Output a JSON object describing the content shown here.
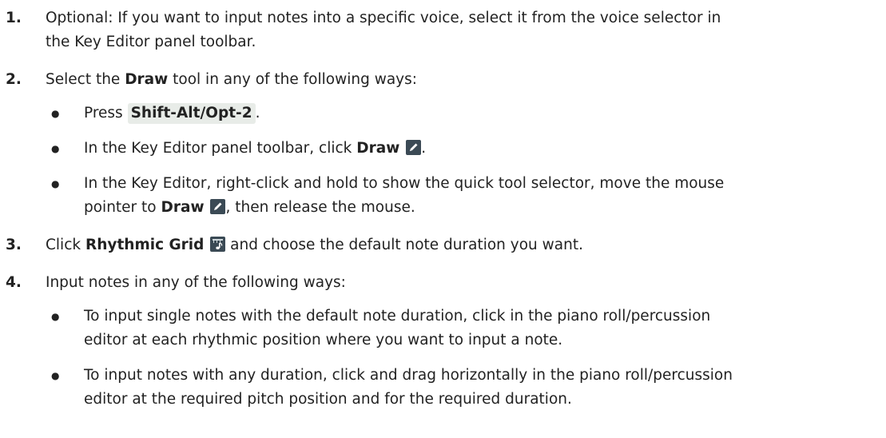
{
  "steps": [
    {
      "number": "1.",
      "line1": "Optional: If you want to input notes into a specific voice, select it from the voice selector in",
      "line2": "the Key Editor panel toolbar."
    },
    {
      "number": "2.",
      "text": "Select the ",
      "bold": "Draw",
      "text_after": " tool in any of the following ways:",
      "bullets": [
        {
          "pre": "Press ",
          "kbd": "Shift-Alt/Opt-2",
          "post": "."
        },
        {
          "pre": "In the Key Editor panel toolbar, click ",
          "bold": "Draw",
          "icon": "pencil-icon",
          "post": "."
        },
        {
          "line1": "In the Key Editor, right-click and hold to show the quick tool selector, move the mouse",
          "pre": "pointer to ",
          "bold": "Draw",
          "icon": "pencil-icon",
          "post": ", then release the mouse."
        }
      ]
    },
    {
      "number": "3.",
      "pre": "Click ",
      "bold": "Rhythmic Grid",
      "icon": "rhythmic-grid-icon",
      "post": " and choose the default note duration you want."
    },
    {
      "number": "4.",
      "text": "Input notes in any of the following ways:",
      "bullets": [
        {
          "line1": "To input single notes with the default note duration, click in the piano roll/percussion",
          "line2": "editor at each rhythmic position where you want to input a note."
        },
        {
          "line1": "To input notes with any duration, click and drag horizontally in the piano roll/percussion",
          "line2": "editor at the required pitch position and for the required duration."
        }
      ]
    }
  ],
  "bullet_char": "●",
  "colors": {
    "text": "#222222",
    "kbd_bg": "#e8ece8",
    "icon_bg": "#3b4a55"
  }
}
